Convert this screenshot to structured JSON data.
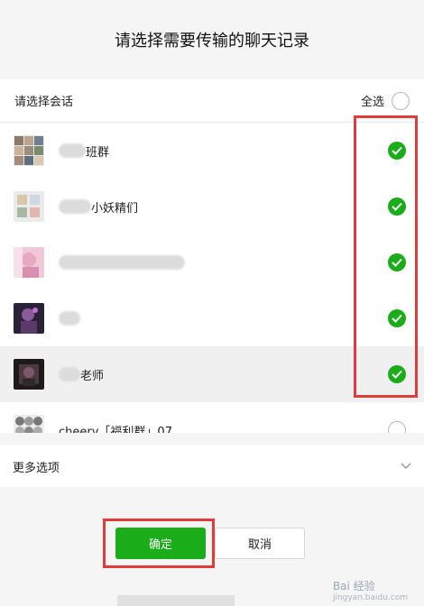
{
  "dialog": {
    "title": "请选择需要传输的聊天记录"
  },
  "list_header": {
    "label": "请选择会话",
    "select_all": "全选"
  },
  "conversations": [
    {
      "name": "班群",
      "checked": true
    },
    {
      "name": "小妖精们",
      "checked": true
    },
    {
      "name": "",
      "checked": true
    },
    {
      "name": "",
      "checked": true
    },
    {
      "name": "老师",
      "checked": true
    },
    {
      "name": "cheery「福利群」07",
      "checked": false
    }
  ],
  "more_options": {
    "label": "更多选项"
  },
  "buttons": {
    "ok": "确定",
    "cancel": "取消"
  },
  "watermark": {
    "brand": "Bai 经验",
    "sub": "jingyan.baidu.com"
  },
  "colors": {
    "accent": "#1aad19",
    "highlight_box": "#e03c3c"
  }
}
